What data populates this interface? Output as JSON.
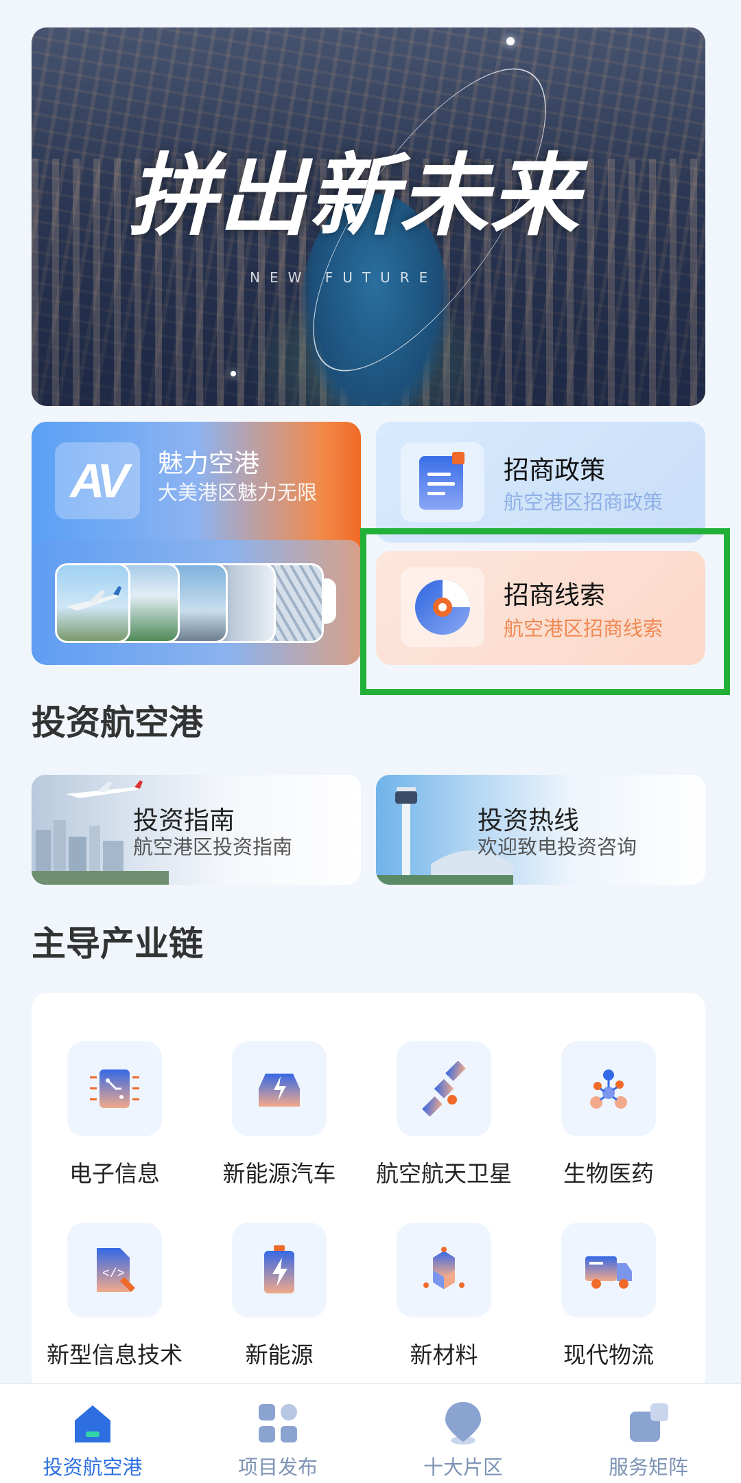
{
  "banner": {
    "headline": "拼出新未来",
    "subtitle": "NEW FUTURE"
  },
  "cards": {
    "charm": {
      "title": "魅力空港",
      "subtitle": "大美港区魅力无限",
      "logo_text": "AV"
    },
    "policy": {
      "title": "招商政策",
      "subtitle": "航空港区招商政策"
    },
    "leads": {
      "title": "招商线索",
      "subtitle": "航空港区招商线索"
    }
  },
  "sections": {
    "invest_title": "投资航空港",
    "industry_title": "主导产业链"
  },
  "invest": [
    {
      "title": "投资指南",
      "subtitle": "航空港区投资指南"
    },
    {
      "title": "投资热线",
      "subtitle": "欢迎致电投资咨询"
    }
  ],
  "industries": [
    {
      "label": "电子信息",
      "icon": "circuit-chip-icon"
    },
    {
      "label": "新能源汽车",
      "icon": "car-bolt-icon"
    },
    {
      "label": "航空航天卫星",
      "icon": "satellite-icon"
    },
    {
      "label": "生物医药",
      "icon": "molecule-icon"
    },
    {
      "label": "新型信息技术",
      "icon": "code-document-icon"
    },
    {
      "label": "新能源",
      "icon": "battery-bolt-icon"
    },
    {
      "label": "新材料",
      "icon": "material-structure-icon"
    },
    {
      "label": "现代物流",
      "icon": "truck-icon"
    }
  ],
  "tabs": [
    {
      "label": "投资航空港",
      "icon": "home-icon",
      "active": true
    },
    {
      "label": "项目发布",
      "icon": "grid-icon",
      "active": false
    },
    {
      "label": "十大片区",
      "icon": "location-pin-icon",
      "active": false
    },
    {
      "label": "服务矩阵",
      "icon": "layers-icon",
      "active": false
    }
  ],
  "colors": {
    "accent": "#2d6fe0",
    "highlight": "#21b038",
    "orange": "#ef6a25"
  }
}
